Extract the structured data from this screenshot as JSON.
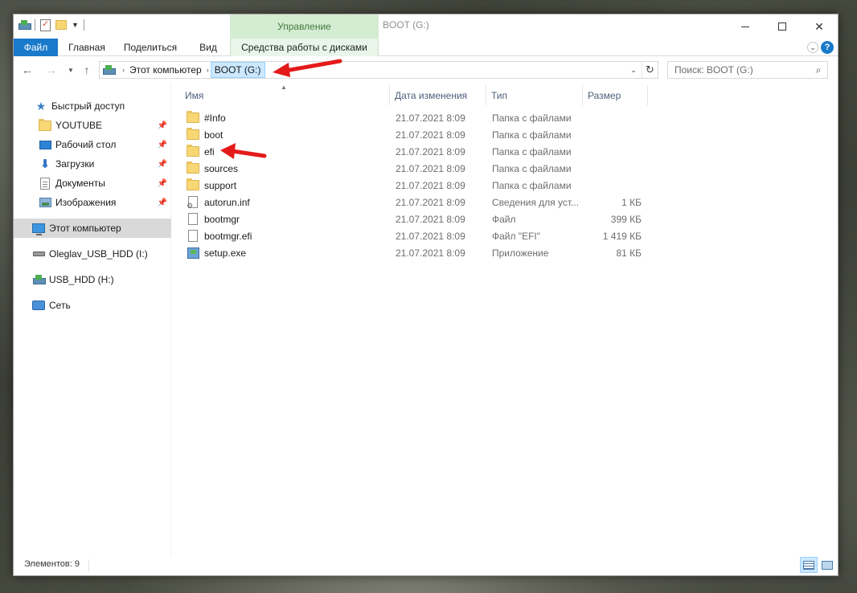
{
  "window": {
    "title": "BOOT (G:)",
    "context_tab_header": "Управление"
  },
  "ribbon": {
    "tabs": [
      {
        "label": "Файл"
      },
      {
        "label": "Главная"
      },
      {
        "label": "Поделиться"
      },
      {
        "label": "Вид"
      },
      {
        "label": "Средства работы с дисками"
      }
    ]
  },
  "address": {
    "crumbs": [
      "Этот компьютер",
      "BOOT (G:)"
    ]
  },
  "search": {
    "placeholder": "Поиск: BOOT (G:)"
  },
  "columns": {
    "name": "Имя",
    "date": "Дата изменения",
    "type": "Тип",
    "size": "Размер"
  },
  "nav": {
    "quick_access": "Быстрый доступ",
    "items": [
      {
        "label": "YOUTUBE",
        "icon": "folder-icon",
        "pinned": true
      },
      {
        "label": "Рабочий стол",
        "icon": "desktop-icon",
        "pinned": true
      },
      {
        "label": "Загрузки",
        "icon": "downloads-icon",
        "pinned": true
      },
      {
        "label": "Документы",
        "icon": "documents-icon",
        "pinned": true
      },
      {
        "label": "Изображения",
        "icon": "pictures-icon",
        "pinned": true
      }
    ],
    "this_pc": "Этот компьютер",
    "drive1": "Oleglav_USB_HDD (I:)",
    "drive2": "USB_HDD (H:)",
    "network": "Сеть"
  },
  "files": [
    {
      "name": "#Info",
      "date": "21.07.2021 8:09",
      "type": "Папка с файлами",
      "size": "",
      "icon": "folder-icon"
    },
    {
      "name": "boot",
      "date": "21.07.2021 8:09",
      "type": "Папка с файлами",
      "size": "",
      "icon": "folder-icon"
    },
    {
      "name": "efi",
      "date": "21.07.2021 8:09",
      "type": "Папка с файлами",
      "size": "",
      "icon": "folder-icon"
    },
    {
      "name": "sources",
      "date": "21.07.2021 8:09",
      "type": "Папка с файлами",
      "size": "",
      "icon": "folder-icon"
    },
    {
      "name": "support",
      "date": "21.07.2021 8:09",
      "type": "Папка с файлами",
      "size": "",
      "icon": "folder-icon"
    },
    {
      "name": "autorun.inf",
      "date": "21.07.2021 8:09",
      "type": "Сведения для уст...",
      "size": "1 КБ",
      "icon": "inf-file-icon"
    },
    {
      "name": "bootmgr",
      "date": "21.07.2021 8:09",
      "type": "Файл",
      "size": "399 КБ",
      "icon": "file-icon"
    },
    {
      "name": "bootmgr.efi",
      "date": "21.07.2021 8:09",
      "type": "Файл \"EFI\"",
      "size": "1 419 КБ",
      "icon": "file-icon"
    },
    {
      "name": "setup.exe",
      "date": "21.07.2021 8:09",
      "type": "Приложение",
      "size": "81 КБ",
      "icon": "exe-icon"
    }
  ],
  "status": {
    "item_count": "Элементов: 9"
  },
  "colors": {
    "file_tab": "#1979ca",
    "context_tab": "#d4ecd2",
    "selection": "#cce8ff",
    "annotation_arrow": "#e41a1a"
  }
}
